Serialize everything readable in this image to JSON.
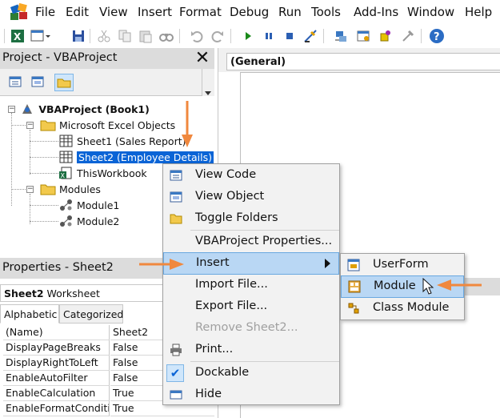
{
  "menubar": {
    "items": [
      "File",
      "Edit",
      "View",
      "Insert",
      "Format",
      "Debug",
      "Run",
      "Tools",
      "Add-Ins",
      "Window",
      "Help"
    ]
  },
  "project_panel": {
    "title": "Project - VBAProject",
    "tree": {
      "root": "VBAProject (Book1)",
      "excel_objects": "Microsoft Excel Objects",
      "sheet1": "Sheet1 (Sales Report)",
      "sheet2": "Sheet2 (Employee Details)",
      "workbook": "ThisWorkbook",
      "modules": "Modules",
      "module1": "Module1",
      "module2": "Module2"
    }
  },
  "properties_panel": {
    "title": "Properties - Sheet2",
    "object_name": "Sheet2",
    "object_type": "Worksheet",
    "tabs": [
      "Alphabetic",
      "Categorized"
    ],
    "rows": [
      {
        "name": "(Name)",
        "value": "Sheet2"
      },
      {
        "name": "DisplayPageBreaks",
        "value": "False"
      },
      {
        "name": "DisplayRightToLeft",
        "value": "False"
      },
      {
        "name": "EnableAutoFilter",
        "value": "False"
      },
      {
        "name": "EnableCalculation",
        "value": "True"
      },
      {
        "name": "EnableFormatConditions",
        "value": "True"
      }
    ]
  },
  "code_window": {
    "object_combo": "(General)"
  },
  "context_menu": {
    "items": {
      "view_code": "View Code",
      "view_object": "View Object",
      "toggle_folders": "Toggle Folders",
      "properties": "VBAProject Properties...",
      "insert": "Insert",
      "import_file": "Import File...",
      "export_file": "Export File...",
      "remove": "Remove Sheet2...",
      "print": "Print...",
      "dockable": "Dockable",
      "hide": "Hide"
    }
  },
  "insert_submenu": {
    "items": {
      "userform": "UserForm",
      "module": "Module",
      "class_module": "Class Module"
    }
  },
  "colors": {
    "selection": "#0a64d6",
    "hover": "#b9d7f4",
    "annotation_arrow": "#f0883e"
  }
}
